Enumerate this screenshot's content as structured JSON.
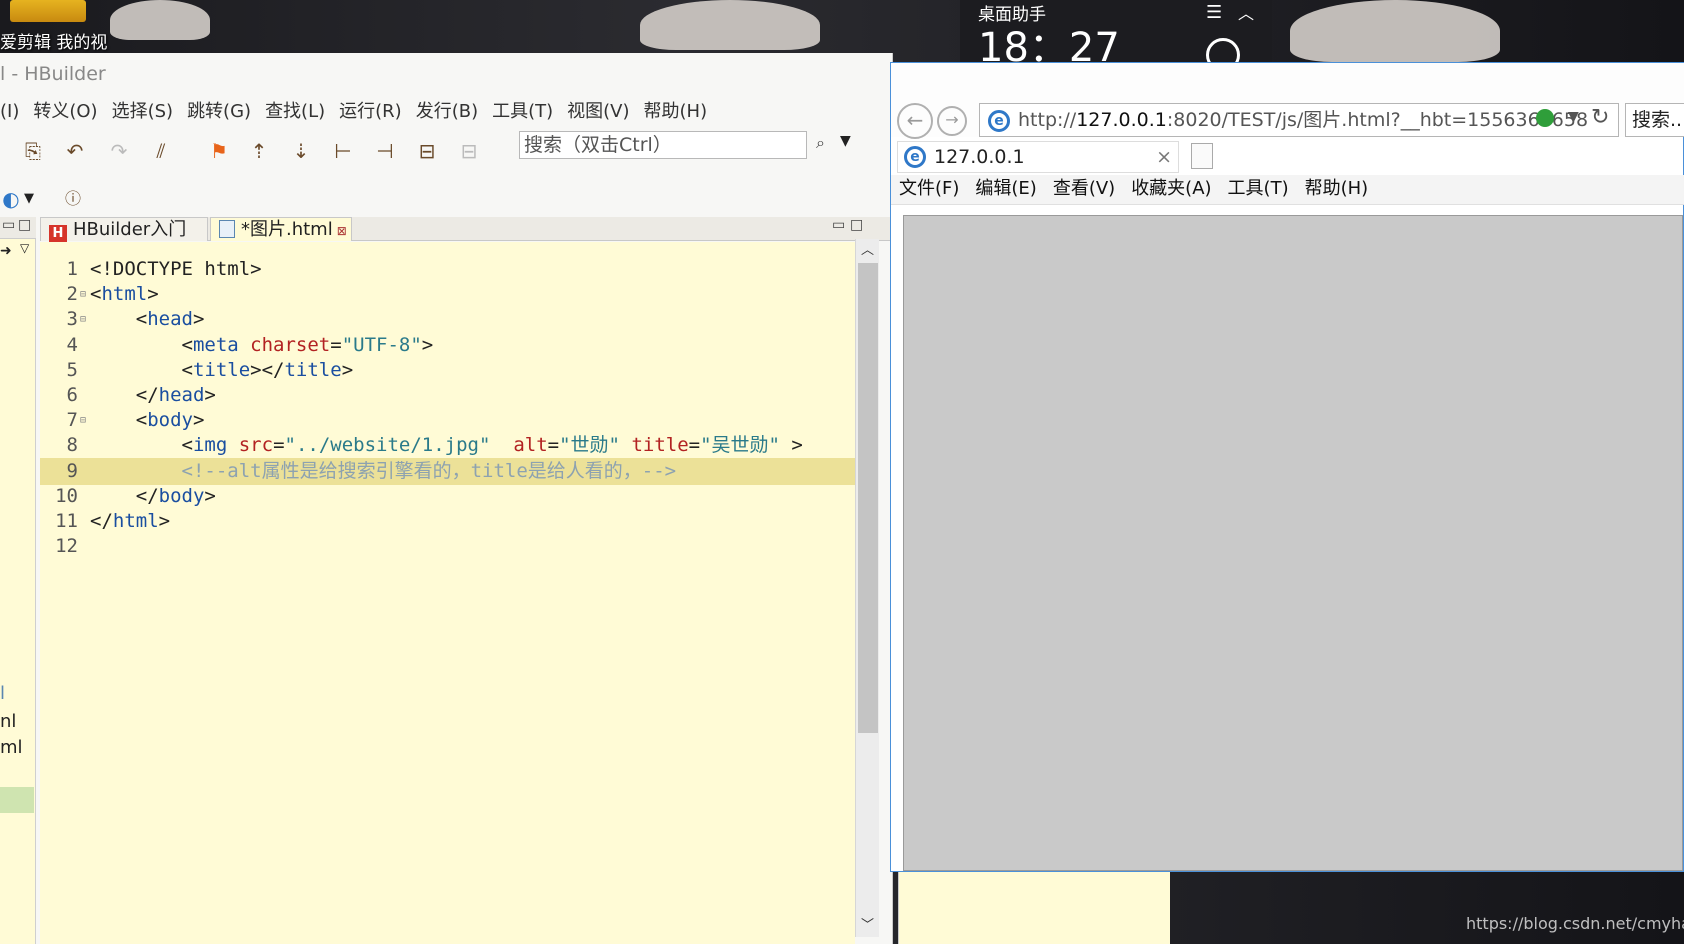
{
  "desktop": {
    "icon_label": "爱剪辑 我的视",
    "widget": {
      "title": "桌面助手",
      "time": "18：27"
    },
    "watermark": "https://blog.csdn.net/cmyhahh"
  },
  "hbuilder": {
    "title": "l  -  HBuilder",
    "menu": [
      "(I)",
      "转义(O)",
      "选择(S)",
      "跳转(G)",
      "查找(L)",
      "运行(R)",
      "发行(B)",
      "工具(T)",
      "视图(V)",
      "帮助(H)"
    ],
    "search_placeholder": "搜索（双击Ctrl）",
    "left_items": [
      "l",
      "nl",
      "ml"
    ],
    "tabs": [
      {
        "label": "HBuilder入门"
      },
      {
        "label": "*图片.html"
      }
    ],
    "lines": [
      {
        "n": "1",
        "tokens": [
          {
            "c": "t-plain",
            "t": "<!DOCTYPE html>"
          }
        ]
      },
      {
        "n": "2",
        "fold": true,
        "tokens": [
          {
            "c": "t-plain",
            "t": "<"
          },
          {
            "c": "t-tag",
            "t": "html"
          },
          {
            "c": "t-plain",
            "t": ">"
          }
        ]
      },
      {
        "n": "3",
        "fold": true,
        "tokens": [
          {
            "c": "t-plain",
            "t": "    <"
          },
          {
            "c": "t-tag",
            "t": "head"
          },
          {
            "c": "t-plain",
            "t": ">"
          }
        ]
      },
      {
        "n": "4",
        "tokens": [
          {
            "c": "t-plain",
            "t": "        <"
          },
          {
            "c": "t-tag",
            "t": "meta"
          },
          {
            "c": "t-plain",
            "t": " "
          },
          {
            "c": "t-attr",
            "t": "charset"
          },
          {
            "c": "t-plain",
            "t": "="
          },
          {
            "c": "t-str",
            "t": "\"UTF-8\""
          },
          {
            "c": "t-plain",
            "t": ">"
          }
        ]
      },
      {
        "n": "5",
        "tokens": [
          {
            "c": "t-plain",
            "t": "        <"
          },
          {
            "c": "t-tag",
            "t": "title"
          },
          {
            "c": "t-plain",
            "t": "></"
          },
          {
            "c": "t-tag",
            "t": "title"
          },
          {
            "c": "t-plain",
            "t": ">"
          }
        ]
      },
      {
        "n": "6",
        "tokens": [
          {
            "c": "t-plain",
            "t": "    </"
          },
          {
            "c": "t-tag",
            "t": "head"
          },
          {
            "c": "t-plain",
            "t": ">"
          }
        ]
      },
      {
        "n": "7",
        "fold": true,
        "tokens": [
          {
            "c": "t-plain",
            "t": "    <"
          },
          {
            "c": "t-tag",
            "t": "body"
          },
          {
            "c": "t-plain",
            "t": ">"
          }
        ]
      },
      {
        "n": "8",
        "tokens": [
          {
            "c": "t-plain",
            "t": "        <"
          },
          {
            "c": "t-tag",
            "t": "img"
          },
          {
            "c": "t-plain",
            "t": " "
          },
          {
            "c": "t-attr",
            "t": "src"
          },
          {
            "c": "t-plain",
            "t": "="
          },
          {
            "c": "t-str",
            "t": "\"../website/1.jpg\""
          },
          {
            "c": "t-plain",
            "t": "  "
          },
          {
            "c": "t-attr",
            "t": "alt"
          },
          {
            "c": "t-plain",
            "t": "="
          },
          {
            "c": "t-str",
            "t": "\"世勋\""
          },
          {
            "c": "t-plain",
            "t": " "
          },
          {
            "c": "t-attr",
            "t": "title"
          },
          {
            "c": "t-plain",
            "t": "="
          },
          {
            "c": "t-str",
            "t": "\"吴世勋\""
          },
          {
            "c": "t-plain",
            "t": " >"
          }
        ]
      },
      {
        "n": "9",
        "current": true,
        "tokens": [
          {
            "c": "t-comment",
            "t": "        <!--alt属性是给搜索引擎看的，title是给人看的，-->"
          }
        ]
      },
      {
        "n": "10",
        "tokens": [
          {
            "c": "t-plain",
            "t": "    </"
          },
          {
            "c": "t-tag",
            "t": "body"
          },
          {
            "c": "t-plain",
            "t": ">"
          }
        ]
      },
      {
        "n": "11",
        "tokens": [
          {
            "c": "t-plain",
            "t": "</"
          },
          {
            "c": "t-tag",
            "t": "html"
          },
          {
            "c": "t-plain",
            "t": ">"
          }
        ]
      },
      {
        "n": "12",
        "tokens": []
      }
    ]
  },
  "browser": {
    "url_prefix": "http://",
    "url_host": "127.0.0.1",
    "url_rest": ":8020/TEST/js/图片.html?__hbt=1556360658",
    "search_label": "搜索...",
    "tab_title": "127.0.0.1",
    "menu": [
      "文件(F)",
      "编辑(E)",
      "查看(V)",
      "收藏夹(A)",
      "工具(T)",
      "帮助(H)"
    ]
  },
  "colors": {
    "editor_bg": "#fffbd6",
    "current_line": "#ece198",
    "tag": "#1a4ea0",
    "attr": "#b22222",
    "string": "#2a7a8a",
    "comment": "#8da2b0"
  }
}
